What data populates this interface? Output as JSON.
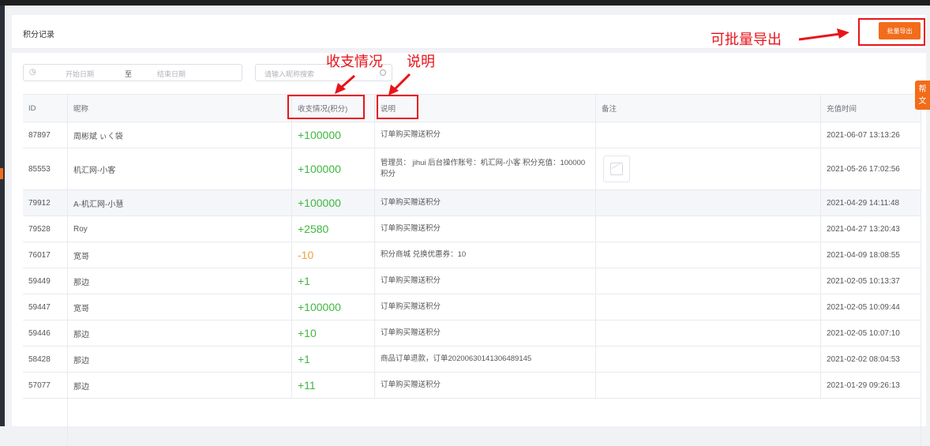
{
  "header": {
    "title": "积分记录",
    "export_label": "批量导出"
  },
  "filters": {
    "start_placeholder": "开始日期",
    "separator": "至",
    "end_placeholder": "结束日期",
    "search_placeholder": "请输入昵称搜索"
  },
  "table": {
    "columns": [
      "ID",
      "昵称",
      "收支情况(积分)",
      "说明",
      "备注",
      "充值时间"
    ],
    "rows": [
      {
        "id": "87897",
        "nickname": "周彬斌 ぃㄑ袋",
        "amount": "+100000",
        "type": "pos",
        "desc": "订单购买赠送积分",
        "note": "",
        "time": "2021-06-07 13:13:26"
      },
      {
        "id": "85553",
        "nickname": "机汇网-小客",
        "amount": "+100000",
        "type": "pos",
        "desc": "管理员： jihui 后台操作账号：机汇网-小客 积分充值：100000 积分",
        "note": "image-placeholder",
        "time": "2021-05-26 17:02:56"
      },
      {
        "id": "79912",
        "nickname": "A-机汇网-小慧",
        "amount": "+100000",
        "type": "pos",
        "desc": "订单购买赠送积分",
        "note": "",
        "time": "2021-04-29 14:11:48"
      },
      {
        "id": "79528",
        "nickname": "Roy",
        "amount": "+2580",
        "type": "pos",
        "desc": "订单购买赠送积分",
        "note": "",
        "time": "2021-04-27 13:20:43"
      },
      {
        "id": "76017",
        "nickname": "宽哥",
        "amount": "-10",
        "type": "neg",
        "desc": "积分商城 兑换优惠券：10",
        "note": "",
        "time": "2021-04-09 18:08:55"
      },
      {
        "id": "59449",
        "nickname": "那边",
        "amount": "+1",
        "type": "pos",
        "desc": "订单购买赠送积分",
        "note": "",
        "time": "2021-02-05 10:13:37"
      },
      {
        "id": "59447",
        "nickname": "宽哥",
        "amount": "+100000",
        "type": "pos",
        "desc": "订单购买赠送积分",
        "note": "",
        "time": "2021-02-05 10:09:44"
      },
      {
        "id": "59446",
        "nickname": "那边",
        "amount": "+10",
        "type": "pos",
        "desc": "订单购买赠送积分",
        "note": "",
        "time": "2021-02-05 10:07:10"
      },
      {
        "id": "58428",
        "nickname": "那边",
        "amount": "+1",
        "type": "pos",
        "desc": "商品订单退款，订单20200630141306489145",
        "note": "",
        "time": "2021-02-02 08:04:53"
      },
      {
        "id": "57077",
        "nickname": "那边",
        "amount": "+11",
        "type": "pos",
        "desc": "订单购买赠送积分",
        "note": "",
        "time": "2021-01-29 09:26:13"
      }
    ]
  },
  "help_tab": {
    "line1": "帮",
    "line2": "文"
  },
  "annotations": {
    "export_note": "可批量导出",
    "amount_note": "收支情况",
    "desc_note": "说明"
  },
  "colors": {
    "accent": "#f26c1a",
    "positive": "#3fb73f",
    "negative": "#f2a23a",
    "annotation": "#e8141b"
  }
}
